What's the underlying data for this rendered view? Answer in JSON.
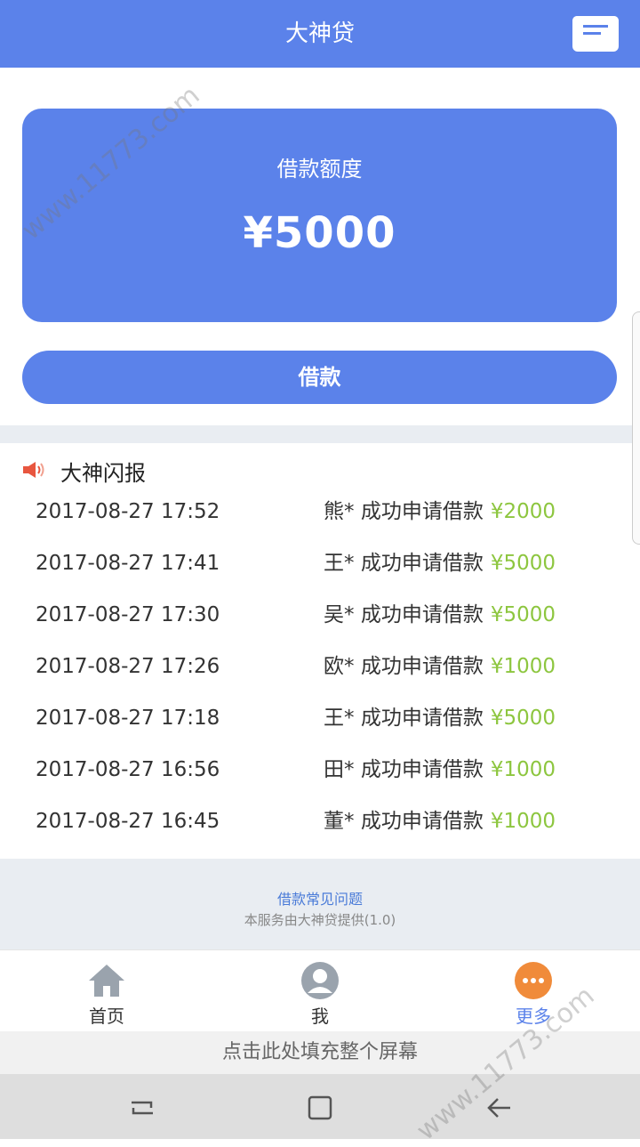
{
  "header": {
    "title": "大神贷",
    "message_icon": "message-icon"
  },
  "quota": {
    "label": "借款额度",
    "amount": "¥5000"
  },
  "borrow_button": {
    "label": "借款"
  },
  "news": {
    "title": "大神闪报",
    "icon": "speaker-icon",
    "rows": [
      {
        "time": "2017-08-27 17:52",
        "name": "熊*",
        "text": "成功申请借款",
        "amount": "¥2000"
      },
      {
        "time": "2017-08-27 17:41",
        "name": "王*",
        "text": "成功申请借款",
        "amount": "¥5000"
      },
      {
        "time": "2017-08-27 17:30",
        "name": "吴*",
        "text": "成功申请借款",
        "amount": "¥5000"
      },
      {
        "time": "2017-08-27 17:26",
        "name": "欧*",
        "text": "成功申请借款",
        "amount": "¥1000"
      },
      {
        "time": "2017-08-27 17:18",
        "name": "王*",
        "text": "成功申请借款",
        "amount": "¥5000"
      },
      {
        "time": "2017-08-27 16:56",
        "name": "田*",
        "text": "成功申请借款",
        "amount": "¥1000"
      },
      {
        "time": "2017-08-27 16:45",
        "name": "董*",
        "text": "成功申请借款",
        "amount": "¥1000"
      }
    ]
  },
  "footer": {
    "faq_link": "借款常见问题",
    "provider": "本服务由大神贷提供(1.0)"
  },
  "tabbar": {
    "tabs": [
      {
        "label": "首页",
        "icon": "home-icon"
      },
      {
        "label": "我",
        "icon": "user-icon"
      },
      {
        "label": "更多",
        "icon": "more-icon"
      }
    ]
  },
  "fill_screen_bar": {
    "label": "点击此处填充整个屏幕"
  },
  "watermark": {
    "text": "www.11773.com"
  },
  "colors": {
    "primary": "#5b82ea",
    "amount_green": "#8dc63f",
    "more_orange": "#f08b3a"
  }
}
